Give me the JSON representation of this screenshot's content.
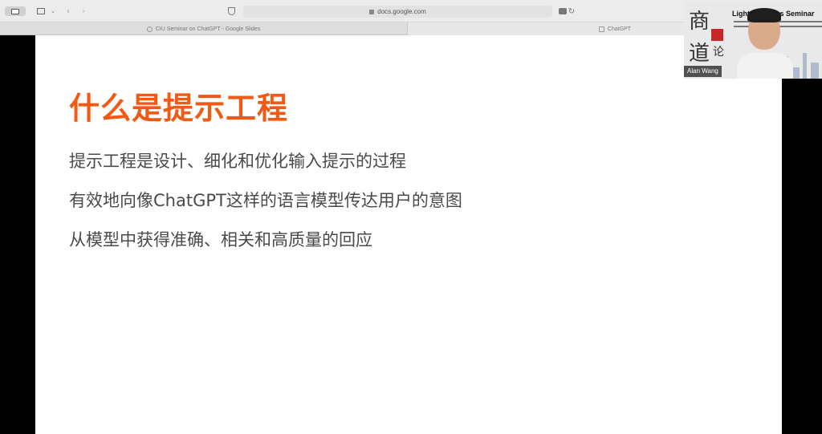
{
  "browser": {
    "address_url": "docs.google.com",
    "tabs": [
      {
        "label": "CIU Seminar on ChatGPT - Google Slides",
        "favicon": "google-icon"
      },
      {
        "label": "ChatGPT",
        "favicon": "chatgpt-icon"
      }
    ],
    "back_glyph": "‹",
    "forward_glyph": "›",
    "reload_glyph": "↻",
    "chevron_glyph": "⌄"
  },
  "slide": {
    "title": "什么是提示工程",
    "title_color": "#f05a14",
    "bullets": [
      "提示工程是设计、细化和优化输入提示的过程",
      "有效地向像ChatGPT这样的语言模型传达用户的意图",
      "从模型中获得准确、相关和高质量的回应"
    ]
  },
  "webcam": {
    "participant_name": "Alan Wang",
    "banner_text": "Light  Business Seminar",
    "calligraphy": [
      "商",
      "道",
      "论"
    ]
  }
}
